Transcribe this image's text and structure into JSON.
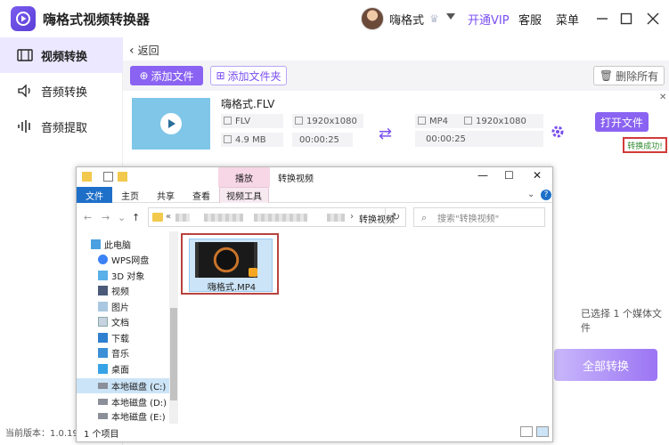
{
  "app": {
    "title": "嗨格式视频转换器",
    "username": "嗨格式",
    "vip_label": "开通VIP",
    "service_label": "客服",
    "menu_label": "菜单"
  },
  "colors": {
    "accent": "#8a63f2",
    "active_bg": "#ece8ff",
    "success": "#2f8a2f"
  },
  "sidebar": {
    "items": [
      {
        "label": "视频转换",
        "icon": "video-convert-icon",
        "active": true
      },
      {
        "label": "音频转换",
        "icon": "audio-convert-icon",
        "active": false
      },
      {
        "label": "音频提取",
        "icon": "audio-extract-icon",
        "active": false
      }
    ]
  },
  "main": {
    "back_label": "返回",
    "add_file_label": "添加文件",
    "add_folder_label": "添加文件夹",
    "delete_all_label": "删除所有",
    "file": {
      "name": "嗨格式.FLV",
      "src_format": "FLV",
      "src_resolution": "1920x1080",
      "src_size": "4.9 MB",
      "src_duration": "00:00:25",
      "dst_format": "MP4",
      "dst_resolution": "1920x1080",
      "dst_duration": "00:00:25",
      "open_file_label": "打开文件",
      "status": "转换成功!"
    },
    "selected_info": "已选择 1 个媒体文件",
    "convert_all_label": "全部转换",
    "version": "当前版本：1.0.19"
  },
  "explorer": {
    "play_tab": "播放",
    "title": "转换视频",
    "tabs": [
      "文件",
      "主页",
      "共享",
      "查看",
      "视频工具"
    ],
    "breadcrumb_folder": "转换视频",
    "search_placeholder": "搜索\"转换视频\"",
    "nav_items": [
      {
        "label": "此电脑",
        "icon": "computer-icon"
      },
      {
        "label": "WPS网盘",
        "icon": "cloud-icon"
      },
      {
        "label": "3D 对象",
        "icon": "cube-icon"
      },
      {
        "label": "视频",
        "icon": "video-folder-icon"
      },
      {
        "label": "图片",
        "icon": "picture-folder-icon"
      },
      {
        "label": "文档",
        "icon": "document-folder-icon"
      },
      {
        "label": "下载",
        "icon": "download-folder-icon"
      },
      {
        "label": "音乐",
        "icon": "music-folder-icon"
      },
      {
        "label": "桌面",
        "icon": "desktop-folder-icon"
      },
      {
        "label": "本地磁盘 (C:)",
        "icon": "drive-icon",
        "selected": true
      },
      {
        "label": "本地磁盘 (D:)",
        "icon": "drive-icon"
      },
      {
        "label": "本地磁盘 (E:)",
        "icon": "drive-icon"
      }
    ],
    "file_name": "嗨格式.MP4",
    "status_count": "1 个项目"
  }
}
